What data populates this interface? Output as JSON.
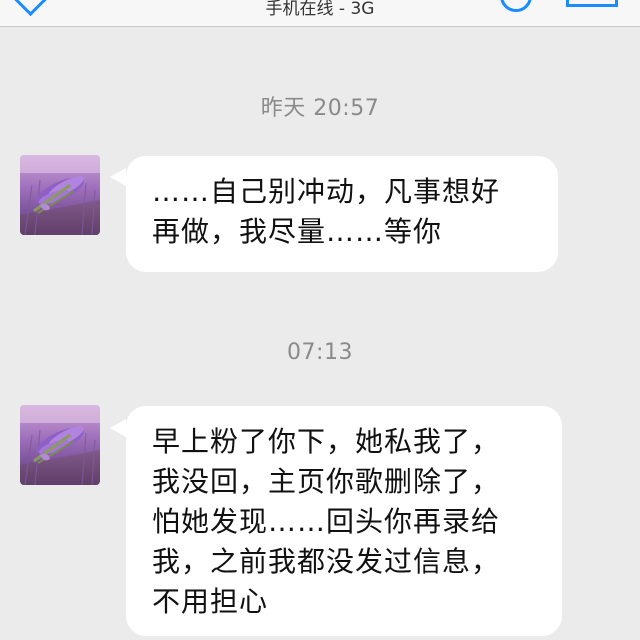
{
  "nav": {
    "subtitle": "手机在线 - 3G",
    "accent_color": "#1a8cff",
    "back_icon": "chevron-left-icon",
    "profile_icon": "person-icon",
    "menu_icon": "menu-icon"
  },
  "messages": [
    {
      "timestamp": "昨天 20:57",
      "sender": "contact",
      "avatar": "lavender-bouquet-avatar",
      "text": "……自己别冲动，凡事想好\n再做，我尽量……等你"
    },
    {
      "timestamp": "07:13",
      "sender": "contact",
      "avatar": "lavender-bouquet-avatar",
      "text": "早上粉了你下，她私我了，\n我没回，主页你歌删除了，\n怕她发现……回头你再录给\n我，之前我都没发过信息，\n不用担心"
    }
  ]
}
